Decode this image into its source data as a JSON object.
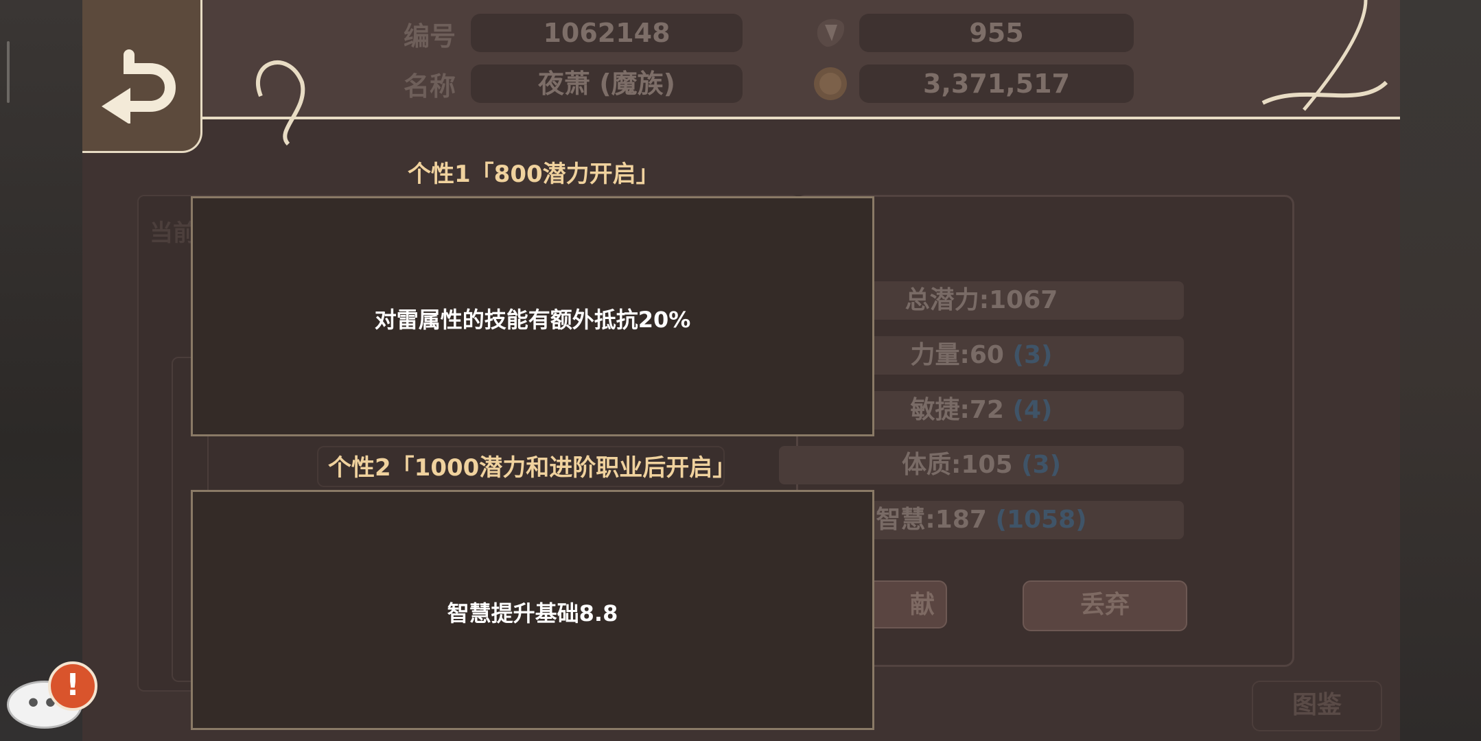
{
  "header": {
    "id_label": "编号",
    "id_value": "1062148",
    "name_label": "名称",
    "name_value": "夜萧 (魔族)",
    "gem_value": "955",
    "gold_value": "3,371,517"
  },
  "traits": {
    "trait1_title": "个性1「800潜力开启」",
    "trait1_text": "对雷属性的技能有额外抵抗20%",
    "trait2_title": "个性2「1000潜力和进阶职业后开启」",
    "trait2_text": "智慧提升基础8.8"
  },
  "stats": {
    "total_potential": "总潜力:1067",
    "strength": "力量:60",
    "strength_bonus": "(3)",
    "agility": "敏捷:72",
    "agility_bonus": "(4)",
    "constitution": "体质:105",
    "constitution_bonus": "(3)",
    "wisdom": "智慧:187",
    "wisdom_bonus": "(1058)"
  },
  "actions": {
    "contribute_partial": "献",
    "discard": "丢弃",
    "catalog": "图鉴"
  },
  "background": {
    "current_partial": "当前"
  },
  "colors": {
    "panel": "#3f3331",
    "header": "#4e3f3c",
    "trait_box": "#342b27",
    "trait_title": "#f0d29e",
    "ornament": "#e8dcc4",
    "alert": "#d9542c"
  },
  "icons": {
    "back": "return-arrow-icon",
    "gem": "gem-icon",
    "gold": "gold-coin-icon",
    "chat": "chat-bubble-icon",
    "alert": "exclamation-icon"
  }
}
